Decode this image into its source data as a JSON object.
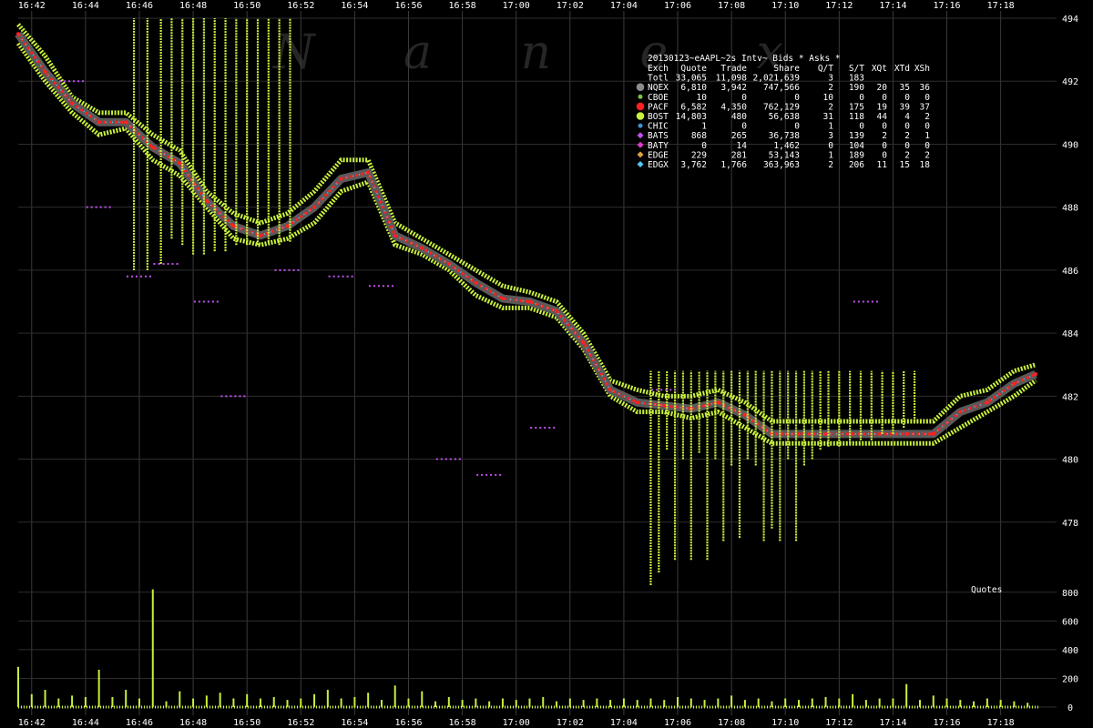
{
  "watermark": "N a n e x",
  "chart_data": {
    "type": "scatter",
    "title": "20130123~eAAPL~2s Intv~ Bids * Asks *",
    "quotes_label": "Quotes",
    "x_ticks": [
      "16:42",
      "16:44",
      "16:46",
      "16:48",
      "16:50",
      "16:52",
      "16:54",
      "16:56",
      "16:58",
      "17:00",
      "17:02",
      "17:04",
      "17:06",
      "17:08",
      "17:10",
      "17:12",
      "17:14",
      "17:16",
      "17:18"
    ],
    "x_start_minutes": 1001.5,
    "x_end_minutes": 1039.4,
    "price_ylim": [
      476,
      494
    ],
    "price_ticks": [
      494,
      492,
      490,
      488,
      486,
      484,
      482,
      480,
      478
    ],
    "volume_ylim": [
      0,
      900
    ],
    "volume_ticks": [
      800,
      600,
      400,
      200,
      0
    ],
    "legend": {
      "columns": [
        "Exch",
        "Quote",
        "Trade",
        "Share",
        "Q/T",
        "S/T",
        "XQt",
        "XTd",
        "XSh"
      ],
      "rows": [
        {
          "exch": "Totl",
          "quote": "33,065",
          "trade": "11,098",
          "share": "2,021,639",
          "qt": "3",
          "st": "183",
          "xqt": "",
          "xtd": "",
          "xsh": "",
          "color": "",
          "marker": "none"
        },
        {
          "exch": "NQEX",
          "quote": "6,810",
          "trade": "3,942",
          "share": "747,566",
          "qt": "2",
          "st": "190",
          "xqt": "20",
          "xtd": "35",
          "xsh": "36",
          "color": "#8c8c8c",
          "marker": "big-circle"
        },
        {
          "exch": "CBOE",
          "quote": "10",
          "trade": "0",
          "share": "0",
          "qt": "10",
          "st": "0",
          "xqt": "0",
          "xtd": "0",
          "xsh": "0",
          "color": "#7fbf3f",
          "marker": "small-circle"
        },
        {
          "exch": "PACF",
          "quote": "6,582",
          "trade": "4,350",
          "share": "762,129",
          "qt": "2",
          "st": "175",
          "xqt": "19",
          "xtd": "39",
          "xsh": "37",
          "color": "#ff2020",
          "marker": "big-circle"
        },
        {
          "exch": "BOST",
          "quote": "14,803",
          "trade": "480",
          "share": "56,638",
          "qt": "31",
          "st": "118",
          "xqt": "44",
          "xtd": "4",
          "xsh": "2",
          "color": "#c8f03c",
          "marker": "big-circle"
        },
        {
          "exch": "CHIC",
          "quote": "1",
          "trade": "0",
          "share": "0",
          "qt": "1",
          "st": "0",
          "xqt": "0",
          "xtd": "0",
          "xsh": "0",
          "color": "#3c96dc",
          "marker": "small-circle"
        },
        {
          "exch": "BATS",
          "quote": "868",
          "trade": "265",
          "share": "36,738",
          "qt": "3",
          "st": "139",
          "xqt": "2",
          "xtd": "2",
          "xsh": "1",
          "color": "#c050f0",
          "marker": "diamond"
        },
        {
          "exch": "BATY",
          "quote": "0",
          "trade": "14",
          "share": "1,462",
          "qt": "0",
          "st": "104",
          "xqt": "0",
          "xtd": "0",
          "xsh": "0",
          "color": "#e03cc8",
          "marker": "diamond"
        },
        {
          "exch": "EDGE",
          "quote": "229",
          "trade": "281",
          "share": "53,143",
          "qt": "1",
          "st": "189",
          "xqt": "0",
          "xtd": "2",
          "xsh": "2",
          "color": "#e0a040",
          "marker": "diamond"
        },
        {
          "exch": "EDGX",
          "quote": "3,762",
          "trade": "1,766",
          "share": "363,963",
          "qt": "2",
          "st": "206",
          "xqt": "11",
          "xtd": "15",
          "xsh": "18",
          "color": "#50c8f0",
          "marker": "diamond"
        }
      ]
    },
    "series": [
      {
        "name": "BOST",
        "role": "bost-quotes",
        "color": "#c8f03c",
        "x": [
          1001.5,
          1002.5,
          1003.5,
          1004.5,
          1005.5,
          1006.5,
          1007.5,
          1008.5,
          1009.5,
          1010.5,
          1011.5,
          1012.5,
          1013.5,
          1014.5,
          1015.5,
          1016.5,
          1017.5,
          1018.5,
          1019.5,
          1020.5,
          1021.5,
          1022.5,
          1023.5,
          1024.5,
          1025.5,
          1026.5,
          1027.5,
          1028.5,
          1029.5,
          1030.5,
          1031.5,
          1032.5,
          1033.5,
          1034.5,
          1035.5,
          1036.5,
          1037.5,
          1038.5,
          1039.3
        ],
        "bid": [
          493.2,
          492.0,
          491.0,
          490.3,
          490.5,
          489.5,
          489.0,
          488.0,
          487.0,
          486.8,
          487.0,
          487.5,
          488.5,
          488.8,
          486.8,
          486.5,
          486.0,
          485.2,
          484.8,
          484.8,
          484.5,
          483.5,
          482.0,
          481.5,
          481.5,
          481.3,
          481.5,
          481.0,
          480.5,
          480.5,
          480.5,
          480.5,
          480.5,
          480.5,
          480.5,
          481.0,
          481.5,
          482.0,
          482.5
        ],
        "ask": [
          493.8,
          492.8,
          491.5,
          491.0,
          491.0,
          490.3,
          489.8,
          488.5,
          487.8,
          487.5,
          487.8,
          488.5,
          489.5,
          489.5,
          487.5,
          487.0,
          486.5,
          486.0,
          485.5,
          485.3,
          485.0,
          484.0,
          482.5,
          482.2,
          482.0,
          482.0,
          482.2,
          481.8,
          481.2,
          481.2,
          481.2,
          481.2,
          481.2,
          481.2,
          481.2,
          482.0,
          482.2,
          482.8,
          483.0
        ]
      },
      {
        "name": "NQEX",
        "role": "nbbo",
        "color": "#8c8c8c",
        "x": [
          1001.5,
          1002.5,
          1003.5,
          1004.5,
          1005.5,
          1006.5,
          1007.5,
          1008.5,
          1009.5,
          1010.5,
          1011.5,
          1012.5,
          1013.5,
          1014.5,
          1015.5,
          1016.5,
          1017.5,
          1018.5,
          1019.5,
          1020.5,
          1021.5,
          1022.5,
          1023.5,
          1024.5,
          1025.5,
          1026.5,
          1027.5,
          1028.5,
          1029.5,
          1030.5,
          1031.5,
          1032.5,
          1033.5,
          1034.5,
          1035.5,
          1036.5,
          1037.5,
          1038.5,
          1039.3
        ],
        "y": [
          493.5,
          492.3,
          491.3,
          490.7,
          490.7,
          489.9,
          489.4,
          488.2,
          487.4,
          487.1,
          487.4,
          488.0,
          488.9,
          489.1,
          487.1,
          486.7,
          486.2,
          485.6,
          485.1,
          485.0,
          484.7,
          483.7,
          482.2,
          481.8,
          481.7,
          481.6,
          481.8,
          481.4,
          480.8,
          480.8,
          480.8,
          480.8,
          480.8,
          480.8,
          480.8,
          481.5,
          481.8,
          482.4,
          482.7
        ]
      },
      {
        "name": "BOST",
        "role": "bost-spikes",
        "color": "#c8f03c",
        "x": [
          1005.8,
          1006.3,
          1006.8,
          1007.2,
          1007.6,
          1008.0,
          1008.4,
          1008.8,
          1009.2,
          1009.6,
          1010.0,
          1010.4,
          1010.8,
          1011.2,
          1011.6,
          1025.0,
          1025.3,
          1025.6,
          1025.9,
          1026.2,
          1026.5,
          1026.8,
          1027.1,
          1027.4,
          1027.7,
          1028.0,
          1028.3,
          1028.6,
          1028.9,
          1029.2,
          1029.5,
          1029.8,
          1030.1,
          1030.4,
          1030.7,
          1031.0,
          1031.3,
          1031.6,
          1032.0,
          1032.4,
          1032.8,
          1033.2,
          1033.6,
          1034.0,
          1034.4,
          1034.8
        ],
        "y_low": [
          486.0,
          486.0,
          486.2,
          487.0,
          486.8,
          486.5,
          486.5,
          486.6,
          486.6,
          486.8,
          486.8,
          486.8,
          486.9,
          486.8,
          486.9,
          476.0,
          476.4,
          480.3,
          476.8,
          480.0,
          476.8,
          480.2,
          476.8,
          480.0,
          477.4,
          479.8,
          477.5,
          480.0,
          479.8,
          477.4,
          477.8,
          477.4,
          480.0,
          477.4,
          479.8,
          480.0,
          480.3,
          480.4,
          480.4,
          480.5,
          480.6,
          480.6,
          480.8,
          480.8,
          481.0,
          481.2
        ],
        "y_high": [
          494.0,
          494.0,
          494.0,
          494.0,
          494.0,
          494.0,
          494.0,
          494.0,
          494.0,
          494.0,
          494.0,
          494.0,
          494.0,
          494.0,
          494.0,
          482.8,
          482.8,
          482.8,
          482.8,
          482.8,
          482.8,
          482.8,
          482.8,
          482.8,
          482.8,
          482.8,
          482.8,
          482.8,
          482.8,
          482.8,
          482.8,
          482.8,
          482.8,
          482.8,
          482.8,
          482.8,
          482.8,
          482.8,
          482.8,
          482.8,
          482.8,
          482.8,
          482.8,
          482.8,
          482.8,
          482.8
        ]
      },
      {
        "name": "BATS",
        "role": "bats-quotes",
        "color": "#c050f0",
        "x": [
          1003.5,
          1004.5,
          1006.0,
          1007.0,
          1008.5,
          1009.5,
          1011.5,
          1013.5,
          1015.0,
          1017.5,
          1019.0,
          1021.0,
          1025.5,
          1033.0
        ],
        "y": [
          492.0,
          488.0,
          485.8,
          486.2,
          485.0,
          482.0,
          486.0,
          485.8,
          485.5,
          480.0,
          479.5,
          481.0,
          482.2,
          485.0
        ]
      }
    ],
    "volume": {
      "name": "Volume",
      "x": [
        1001.5,
        1002.0,
        1002.5,
        1003.0,
        1003.5,
        1004.0,
        1004.5,
        1005.0,
        1005.5,
        1006.0,
        1006.5,
        1007.0,
        1007.5,
        1008.0,
        1008.5,
        1009.0,
        1009.5,
        1010.0,
        1010.5,
        1011.0,
        1011.5,
        1012.0,
        1012.5,
        1013.0,
        1013.5,
        1014.0,
        1014.5,
        1015.0,
        1015.5,
        1016.0,
        1016.5,
        1017.0,
        1017.5,
        1018.0,
        1018.5,
        1019.0,
        1019.5,
        1020.0,
        1020.5,
        1021.0,
        1021.5,
        1022.0,
        1022.5,
        1023.0,
        1023.5,
        1024.0,
        1024.5,
        1025.0,
        1025.5,
        1026.0,
        1026.5,
        1027.0,
        1027.5,
        1028.0,
        1028.5,
        1029.0,
        1029.5,
        1030.0,
        1030.5,
        1031.0,
        1031.5,
        1032.0,
        1032.5,
        1033.0,
        1033.5,
        1034.0,
        1034.5,
        1035.0,
        1035.5,
        1036.0,
        1036.5,
        1037.0,
        1037.5,
        1038.0,
        1038.5,
        1039.0
      ],
      "values": [
        280,
        90,
        120,
        60,
        80,
        70,
        260,
        70,
        120,
        60,
        820,
        40,
        110,
        60,
        80,
        100,
        60,
        90,
        60,
        70,
        50,
        60,
        90,
        120,
        60,
        70,
        100,
        50,
        150,
        60,
        110,
        40,
        70,
        50,
        60,
        40,
        60,
        50,
        60,
        70,
        40,
        60,
        50,
        60,
        50,
        60,
        50,
        60,
        50,
        70,
        60,
        50,
        60,
        80,
        50,
        60,
        40,
        60,
        50,
        60,
        70,
        60,
        90,
        50,
        60,
        60,
        160,
        50,
        80,
        60,
        50,
        40,
        60,
        50,
        40,
        30
      ],
      "color": "#c8f03c"
    }
  }
}
